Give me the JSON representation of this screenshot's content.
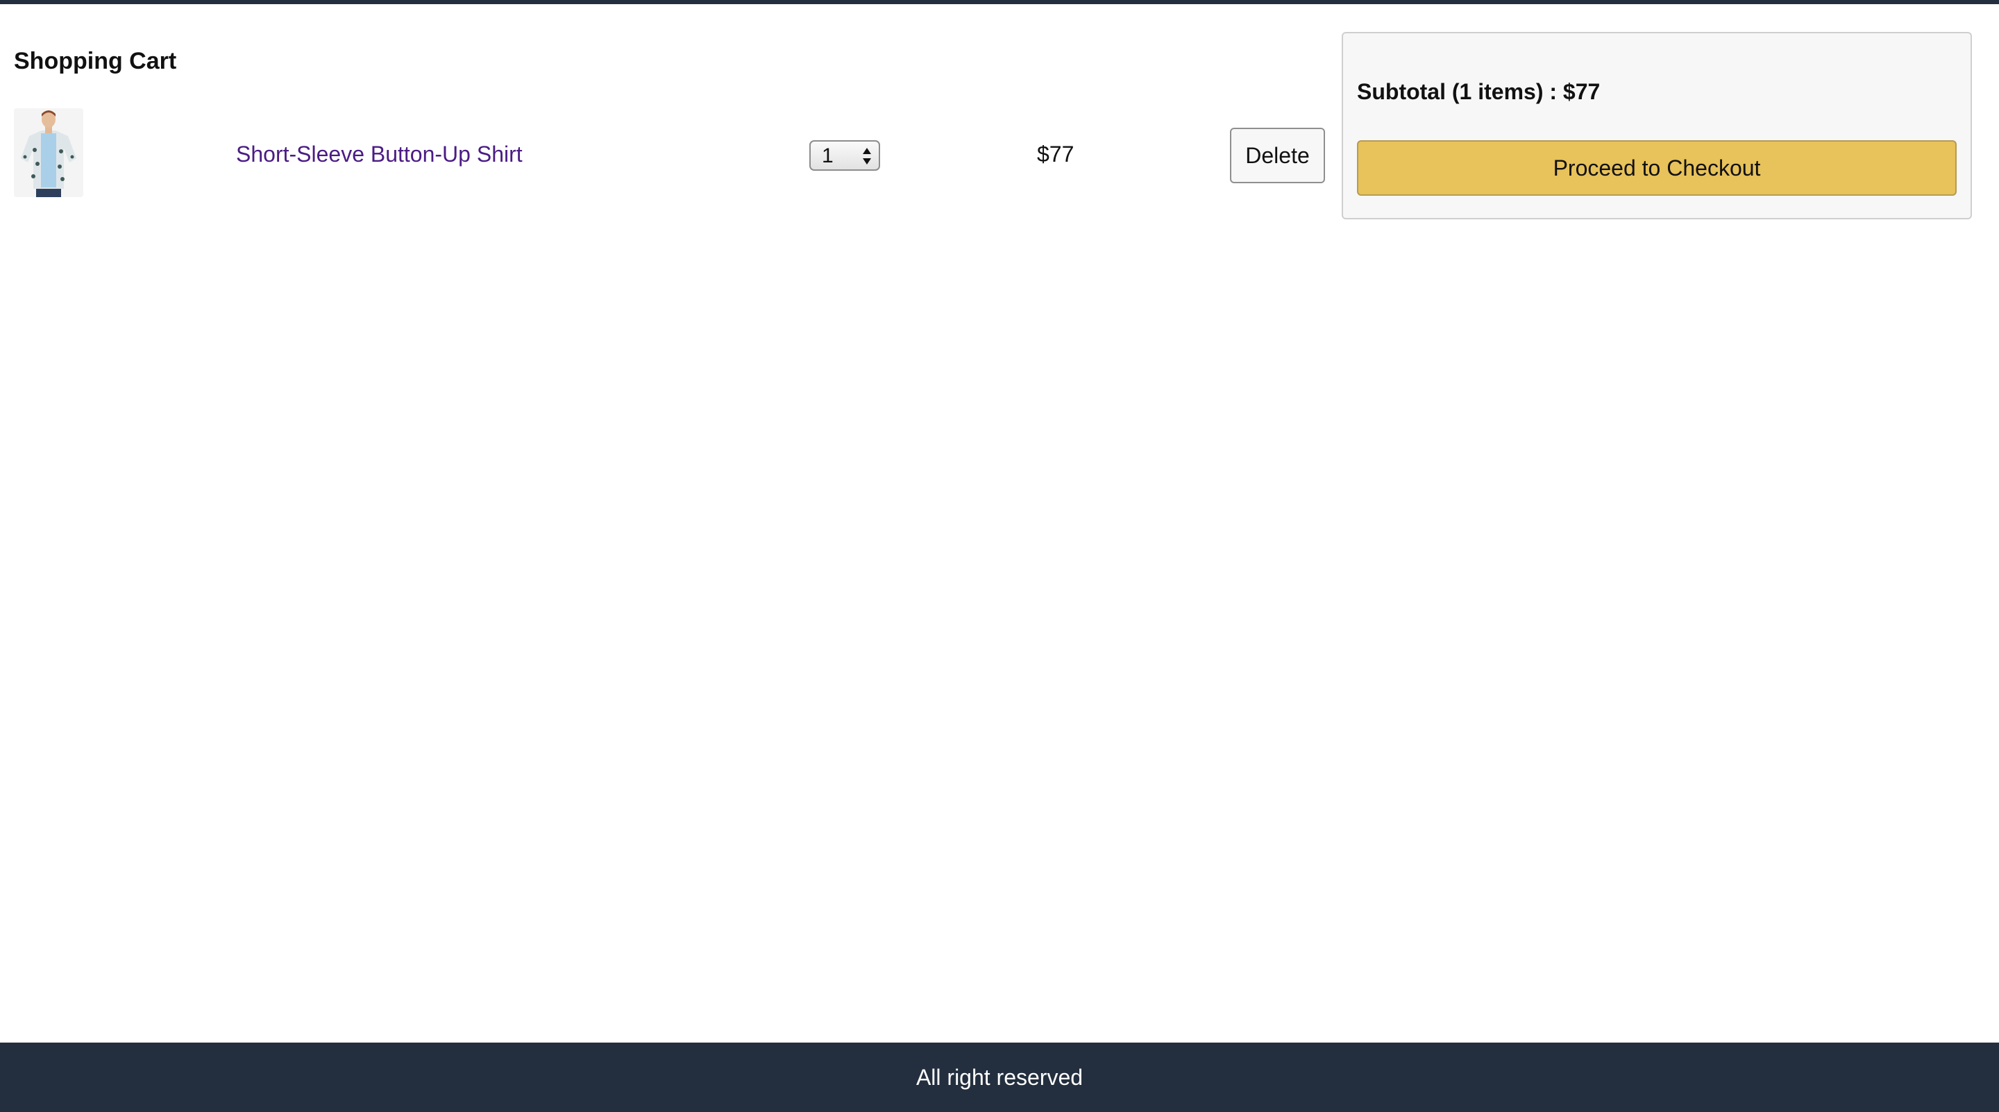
{
  "page": {
    "title": "Shopping Cart"
  },
  "cart": {
    "items": [
      {
        "name": "Short-Sleeve Button-Up Shirt",
        "quantity": "1",
        "price": "$77",
        "delete_label": "Delete",
        "thumbnail_icon": "product-photo-shirt"
      }
    ]
  },
  "summary": {
    "subtotal": "Subtotal (1 items) : $77",
    "checkout_label": "Proceed to Checkout"
  },
  "footer": {
    "text": "All right reserved"
  },
  "colors": {
    "header_footer_bg": "#232f3e",
    "checkout_button": "#e8c25a",
    "product_link": "#4b1c84",
    "summary_bg": "#f7f7f7"
  }
}
